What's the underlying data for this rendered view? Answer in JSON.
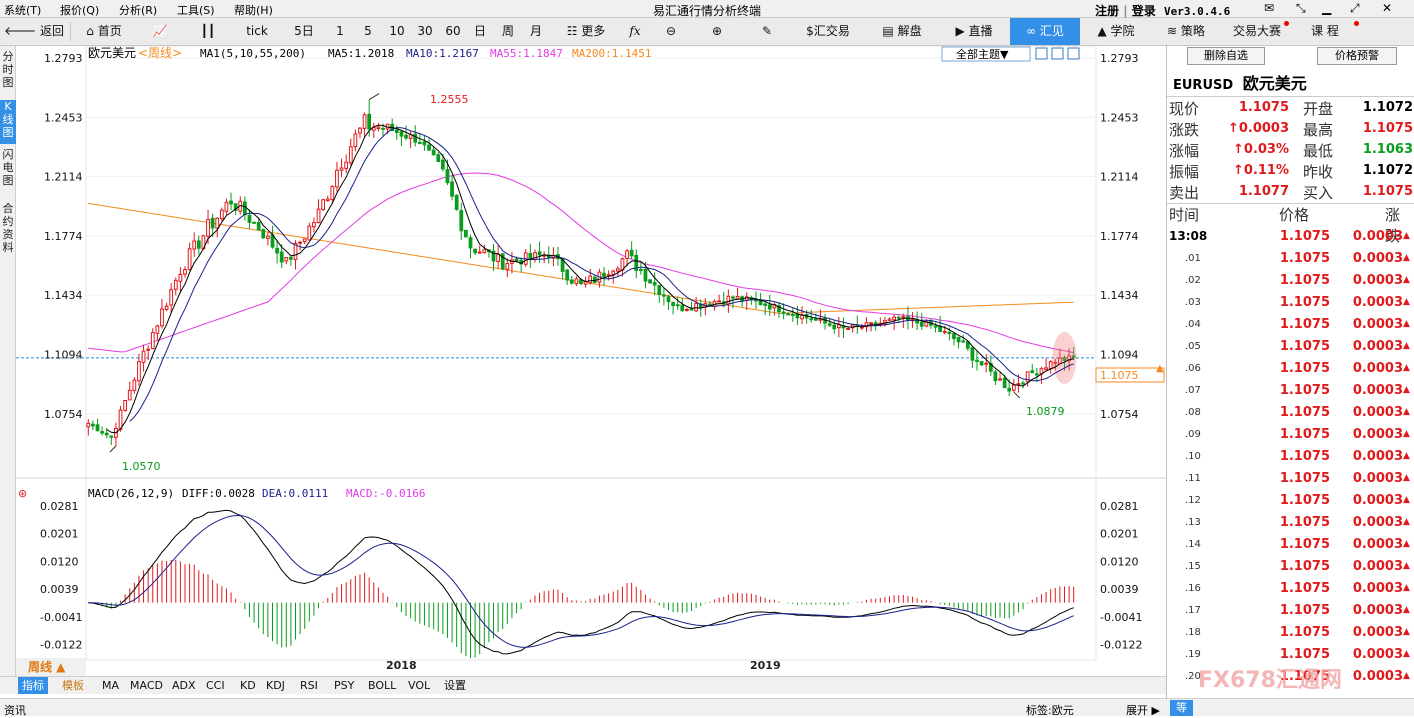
{
  "menu": {
    "items": [
      "系统(T)",
      "报价(Q)",
      "分析(R)",
      "工具(S)",
      "帮助(H)"
    ],
    "title": "易汇通行情分析终端",
    "register": "注册",
    "login": "登录",
    "version": "Ver3.0.4.6"
  },
  "toolbar": {
    "back": "返回",
    "home": "首页",
    "tick": "tick",
    "periods": [
      "5日",
      "1",
      "5",
      "10",
      "30",
      "60",
      "日",
      "周",
      "月"
    ],
    "more": "更多",
    "trade": "汇交易",
    "analysis": "解盘",
    "live": "直播",
    "huijian": "汇见",
    "academy": "学院",
    "strategy": "策略",
    "contest": "交易大赛",
    "course": "课 程"
  },
  "lefttabs": [
    "分时图",
    "K线图",
    "闪电图",
    "合约资料"
  ],
  "chart": {
    "symbol": "欧元美元",
    "period": "<周线>",
    "ma_label": "MA1(5,10,55,200)",
    "ma5": "MA5:1.2018",
    "ma10": "MA10:1.2167",
    "ma55": "MA55:1.1847",
    "ma200": "MA200:1.1451",
    "theme_btn": "全部主题▼",
    "price_ticks": [
      "1.2793",
      "1.2453",
      "1.2114",
      "1.1774",
      "1.1434",
      "1.1094",
      "1.0754"
    ],
    "high_label": "1.2555",
    "low_label": "1.0570",
    "recent_low_label": "1.0879",
    "current_price": "1.1075",
    "macd_label": "MACD(26,12,9)",
    "diff": "DIFF:0.0028",
    "dea": "DEA:0.0111",
    "macd_val": "MACD:-0.0166",
    "macd_ticks": [
      "0.0281",
      "0.0201",
      "0.0120",
      "0.0039",
      "-0.0041",
      "-0.0122"
    ],
    "year_labels": [
      "2018",
      "2019"
    ],
    "period_btn": "周线 ▲",
    "colors": {
      "up": "#e0191b",
      "down": "#0b9c1c",
      "ma5": "#000000",
      "ma10": "#1a1f8a",
      "ma55": "#e23be6",
      "ma200": "#f58a1f"
    }
  },
  "chart_data": {
    "type": "candlestick",
    "title": "欧元美元 周线",
    "ylim": [
      1.057,
      1.2793
    ],
    "anchors": [
      [
        0,
        1.07,
        0.6
      ],
      [
        5,
        1.062,
        1.0
      ],
      [
        12,
        1.11,
        2.4
      ],
      [
        20,
        1.158,
        2.4
      ],
      [
        26,
        1.182,
        3.0
      ],
      [
        31,
        1.198,
        3.0
      ],
      [
        37,
        1.182,
        2.0
      ],
      [
        43,
        1.162,
        2.0
      ],
      [
        50,
        1.19,
        3.0
      ],
      [
        55,
        1.222,
        4.0
      ],
      [
        60,
        1.241,
        3.6
      ],
      [
        65,
        1.239,
        2.0
      ],
      [
        72,
        1.232,
        1.4
      ],
      [
        77,
        1.212,
        3.0
      ],
      [
        83,
        1.172,
        3.0
      ],
      [
        90,
        1.162,
        2.0
      ],
      [
        100,
        1.167,
        1.6
      ],
      [
        107,
        1.148,
        3.0
      ],
      [
        112,
        1.156,
        1.6
      ],
      [
        117,
        1.166,
        2.4
      ],
      [
        122,
        1.152,
        2.0
      ],
      [
        128,
        1.136,
        1.6
      ],
      [
        134,
        1.139,
        1.4
      ],
      [
        140,
        1.142,
        1.4
      ],
      [
        146,
        1.139,
        1.2
      ],
      [
        152,
        1.134,
        1.2
      ],
      [
        158,
        1.129,
        1.0
      ],
      [
        164,
        1.124,
        1.2
      ],
      [
        170,
        1.126,
        1.2
      ],
      [
        176,
        1.13,
        1.0
      ],
      [
        183,
        1.126,
        1.0
      ],
      [
        189,
        1.117,
        1.6
      ],
      [
        195,
        1.101,
        2.0
      ],
      [
        200,
        1.09,
        1.4
      ],
      [
        205,
        1.099,
        1.4
      ],
      [
        210,
        1.106,
        1.2
      ],
      [
        214,
        1.1075,
        1.0
      ]
    ]
  },
  "bottom": {
    "tabs": [
      "指标",
      "模板",
      "MA",
      "MACD",
      "ADX",
      "CCI",
      "KD",
      "KDJ",
      "RSI",
      "PSY",
      "BOLL",
      "VOL",
      "设置"
    ],
    "status_left": "资讯",
    "tag": "标签:欧元",
    "expand": "展开 ▶",
    "status_right": "等"
  },
  "quote": {
    "delete_btn": "删除自选",
    "alert_btn": "价格预警",
    "code": "EURUSD",
    "name": "欧元美元",
    "rows": [
      {
        "l1": "现价",
        "v1": "1.1075",
        "c1": "red",
        "l2": "开盘",
        "v2": "1.1072",
        "c2": "blk"
      },
      {
        "l1": "涨跌",
        "v1": "↑0.0003",
        "c1": "red",
        "l2": "最高",
        "v2": "1.1075",
        "c2": "red"
      },
      {
        "l1": "涨幅",
        "v1": "↑0.03%",
        "c1": "red",
        "l2": "最低",
        "v2": "1.1063",
        "c2": "green"
      },
      {
        "l1": "振幅",
        "v1": "↑0.11%",
        "c1": "red",
        "l2": "昨收",
        "v2": "1.1072",
        "c2": "blk"
      },
      {
        "l1": "卖出",
        "v1": "1.1077",
        "c1": "red",
        "l2": "买入",
        "v2": "1.1075",
        "c2": "red"
      }
    ],
    "hdr_time": "时间",
    "hdr_price": "价格",
    "hdr_change": "涨跌",
    "ticks": [
      {
        "t": "13:08",
        "p": "1.1075",
        "c": "0.0003"
      },
      {
        "t": ".01",
        "p": "1.1075",
        "c": "0.0003"
      },
      {
        "t": ".02",
        "p": "1.1075",
        "c": "0.0003"
      },
      {
        "t": ".03",
        "p": "1.1075",
        "c": "0.0003"
      },
      {
        "t": ".04",
        "p": "1.1075",
        "c": "0.0003"
      },
      {
        "t": ".05",
        "p": "1.1075",
        "c": "0.0003"
      },
      {
        "t": ".06",
        "p": "1.1075",
        "c": "0.0003"
      },
      {
        "t": ".07",
        "p": "1.1075",
        "c": "0.0003"
      },
      {
        "t": ".08",
        "p": "1.1075",
        "c": "0.0003"
      },
      {
        "t": ".09",
        "p": "1.1075",
        "c": "0.0003"
      },
      {
        "t": ".10",
        "p": "1.1075",
        "c": "0.0003"
      },
      {
        "t": ".11",
        "p": "1.1075",
        "c": "0.0003"
      },
      {
        "t": ".12",
        "p": "1.1075",
        "c": "0.0003"
      },
      {
        "t": ".13",
        "p": "1.1075",
        "c": "0.0003"
      },
      {
        "t": ".14",
        "p": "1.1075",
        "c": "0.0003"
      },
      {
        "t": ".15",
        "p": "1.1075",
        "c": "0.0003"
      },
      {
        "t": ".16",
        "p": "1.1075",
        "c": "0.0003"
      },
      {
        "t": ".17",
        "p": "1.1075",
        "c": "0.0003"
      },
      {
        "t": ".18",
        "p": "1.1075",
        "c": "0.0003"
      },
      {
        "t": ".19",
        "p": "1.1075",
        "c": "0.0003"
      },
      {
        "t": ".20",
        "p": "1.1075",
        "c": "0.0003"
      }
    ],
    "watermark": "FX678汇通网"
  }
}
